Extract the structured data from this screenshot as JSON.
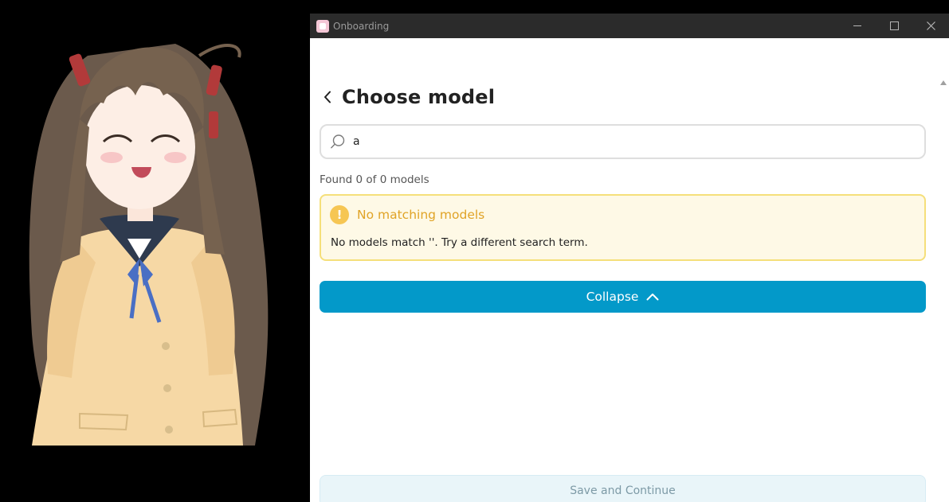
{
  "window": {
    "title": "Onboarding",
    "controls": [
      "minimize-icon",
      "maximize-icon",
      "close-icon"
    ]
  },
  "page": {
    "title": "Choose model",
    "back_icon": "chevron-left-icon"
  },
  "search": {
    "value": "a",
    "icon": "search-icon"
  },
  "results": {
    "found_text": "Found 0 of 0 models"
  },
  "alert": {
    "icon": "warning-icon",
    "icon_glyph": "!",
    "title": "No matching models",
    "message": "No models match ''. Try a different search term."
  },
  "collapse_button": {
    "label": "Collapse",
    "icon": "chevron-up-icon"
  },
  "save_button": {
    "label": "Save and Continue"
  },
  "colors": {
    "accent": "#0399c9",
    "warning": "#f6c653",
    "warning_text": "#e0a326",
    "alert_bg": "#fef9e6",
    "alert_border": "#f5df7a",
    "titlebar": "#2b2b2b"
  }
}
